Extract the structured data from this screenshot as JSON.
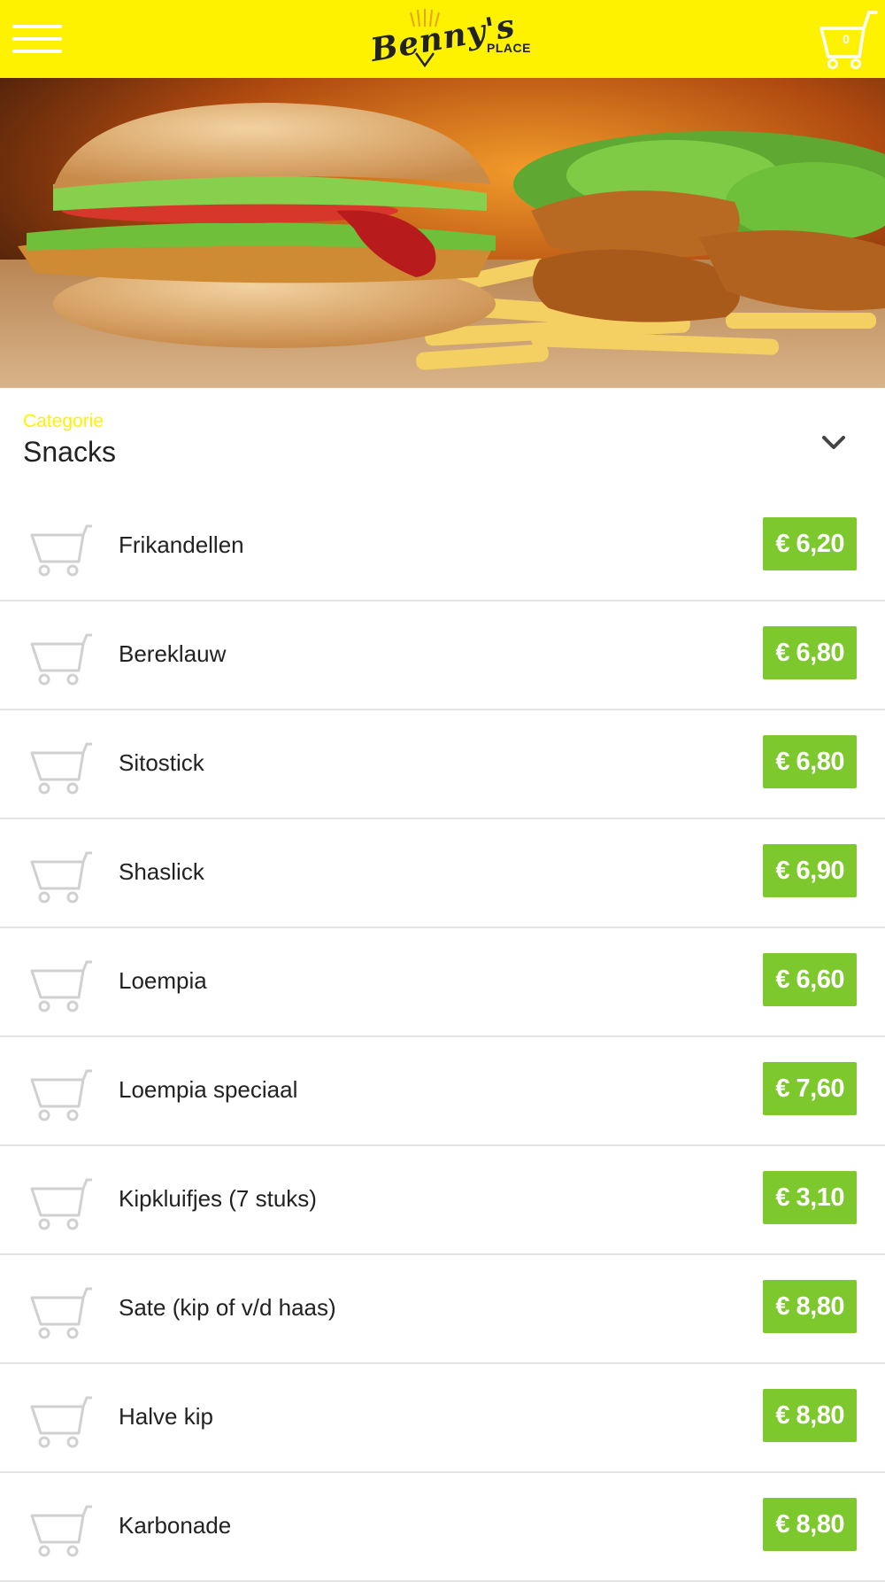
{
  "header": {
    "menu_icon": "hamburger-menu-icon",
    "logo": {
      "script": "Benny's",
      "sub": "PLACE"
    },
    "cart": {
      "icon": "shopping-cart-icon",
      "count": "0"
    },
    "background": "#fff200"
  },
  "hero": {
    "description": "burger-fries-schnitzel-photo"
  },
  "category": {
    "label": "Categorie",
    "value": "Snacks",
    "icon": "chevron-down-icon"
  },
  "items": [
    {
      "name": "Frikandellen",
      "price": "€ 6,20"
    },
    {
      "name": "Bereklauw",
      "price": "€ 6,80"
    },
    {
      "name": "Sitostick",
      "price": "€ 6,80"
    },
    {
      "name": "Shaslick",
      "price": "€ 6,90"
    },
    {
      "name": "Loempia",
      "price": "€ 6,60"
    },
    {
      "name": "Loempia speciaal",
      "price": "€ 7,60"
    },
    {
      "name": "Kipkluifjes (7 stuks)",
      "price": "€ 3,10"
    },
    {
      "name": "Sate (kip of v/d haas)",
      "price": "€ 8,80"
    },
    {
      "name": "Halve kip",
      "price": "€ 8,80"
    },
    {
      "name": "Karbonade",
      "price": "€ 8,80"
    }
  ],
  "colors": {
    "accent_yellow": "#fff200",
    "price_green": "#7dc82d",
    "text": "#222222"
  }
}
